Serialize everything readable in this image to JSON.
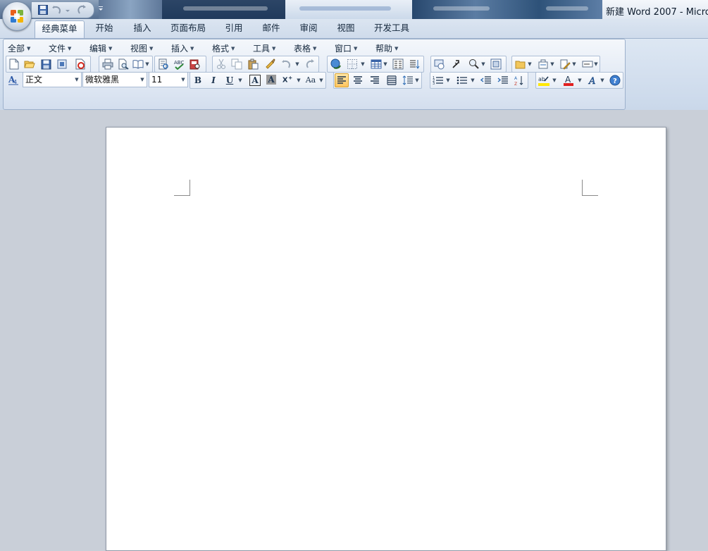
{
  "window": {
    "title": "新建 Word 2007 - Micros"
  },
  "tabs": [
    {
      "label": "经典菜单",
      "active": true
    },
    {
      "label": "开始"
    },
    {
      "label": "插入"
    },
    {
      "label": "页面布局"
    },
    {
      "label": "引用"
    },
    {
      "label": "邮件"
    },
    {
      "label": "审阅"
    },
    {
      "label": "视图"
    },
    {
      "label": "开发工具"
    }
  ],
  "menu": [
    {
      "label": "全部"
    },
    {
      "label": "文件"
    },
    {
      "label": "编辑"
    },
    {
      "label": "视图"
    },
    {
      "label": "插入"
    },
    {
      "label": "格式"
    },
    {
      "label": "工具"
    },
    {
      "label": "表格"
    },
    {
      "label": "窗口"
    },
    {
      "label": "帮助"
    }
  ],
  "format_toolbar": {
    "style_value": "正文",
    "font_value": "微软雅黑",
    "size_value": "11",
    "bold_glyph": "B",
    "italic_glyph": "I",
    "underline_glyph": "U",
    "case_glyph": "Aa",
    "border_glyph": "A",
    "shade_glyph": "A",
    "font_color_glyph": "A",
    "highlight_glyph": "ab",
    "effects_glyph": "A"
  },
  "colors": {
    "accent_orange": "#ffc45f",
    "font_color_red": "#e02020",
    "highlight_yellow": "#ffe800",
    "workspace_gray": "#c9cfd8"
  },
  "icons": {
    "office_button": "office-logo-icon",
    "qat": [
      "save-icon",
      "undo-icon",
      "redo-icon"
    ],
    "standard": [
      "new-icon",
      "open-icon",
      "save-icon",
      "permission-icon",
      "pdf-icon",
      "print-icon",
      "print-preview-icon",
      "read-mode-icon",
      "research-icon",
      "spelling-icon",
      "thesaurus-icon",
      "cut-icon",
      "copy-icon",
      "paste-icon",
      "format-painter-icon",
      "undo-icon",
      "redo-icon",
      "hyperlink-icon",
      "borders-icon",
      "table-icon",
      "columns-icon",
      "text-direction-icon",
      "drawing-icon",
      "navigate-icon",
      "zoom-icon",
      "full-screen-icon",
      "folder-icon",
      "stamp-icon",
      "edit-icon",
      "field-icon"
    ],
    "formatting": [
      "styles-icon",
      "align-left-icon",
      "align-center-icon",
      "align-right-icon",
      "justify-icon",
      "line-spacing-icon",
      "numbering-icon",
      "bullets-icon",
      "decrease-indent-icon",
      "increase-indent-icon",
      "sort-icon",
      "help-icon"
    ]
  }
}
